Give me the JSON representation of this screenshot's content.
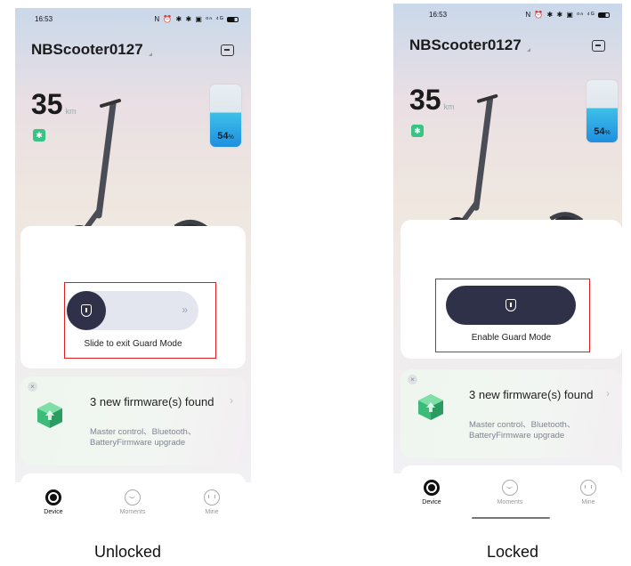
{
  "unlocked": {
    "status_bar": {
      "time": "16:53",
      "icons": "N ⏰ ✱ ✱ ▣ ᵒⁿ ⁴ᴳ"
    },
    "device_name": "NBScooter0127",
    "range": {
      "value": "35",
      "unit": "km"
    },
    "bluetooth_icon": "bluetooth-icon",
    "battery": {
      "percent": "54",
      "symbol": "%",
      "level": 0.54
    },
    "guard": {
      "label": "Slide to exit Guard Mode",
      "arrows": "»"
    },
    "firmware": {
      "title": "3 new firmware(s) found",
      "subtitle": "Master control、Bluetooth、BatteryFirmware upgrade"
    },
    "tabs": [
      {
        "label": "Device"
      },
      {
        "label": "Moments"
      },
      {
        "label": "Mine"
      }
    ],
    "caption": "Unlocked"
  },
  "locked": {
    "status_bar": {
      "time": "16:53",
      "icons": "N ⏰ ✱ ✱ ▣ ᵒⁿ ⁴ᴳ"
    },
    "device_name": "NBScooter0127",
    "range": {
      "value": "35",
      "unit": "km"
    },
    "bluetooth_icon": "bluetooth-icon",
    "battery": {
      "percent": "54",
      "symbol": "%",
      "level": 0.54
    },
    "guard": {
      "label": "Enable Guard Mode"
    },
    "firmware": {
      "title": "3 new firmware(s) found",
      "subtitle": "Master control、Bluetooth、BatteryFirmware upgrade"
    },
    "tabs": [
      {
        "label": "Device"
      },
      {
        "label": "Moments"
      },
      {
        "label": "Mine"
      }
    ],
    "caption": "Locked"
  },
  "colors": {
    "highlight": "#e02020",
    "dark_button": "#2e3147",
    "bluetooth": "#37c585",
    "battery_fill": "#1f8fe0"
  }
}
